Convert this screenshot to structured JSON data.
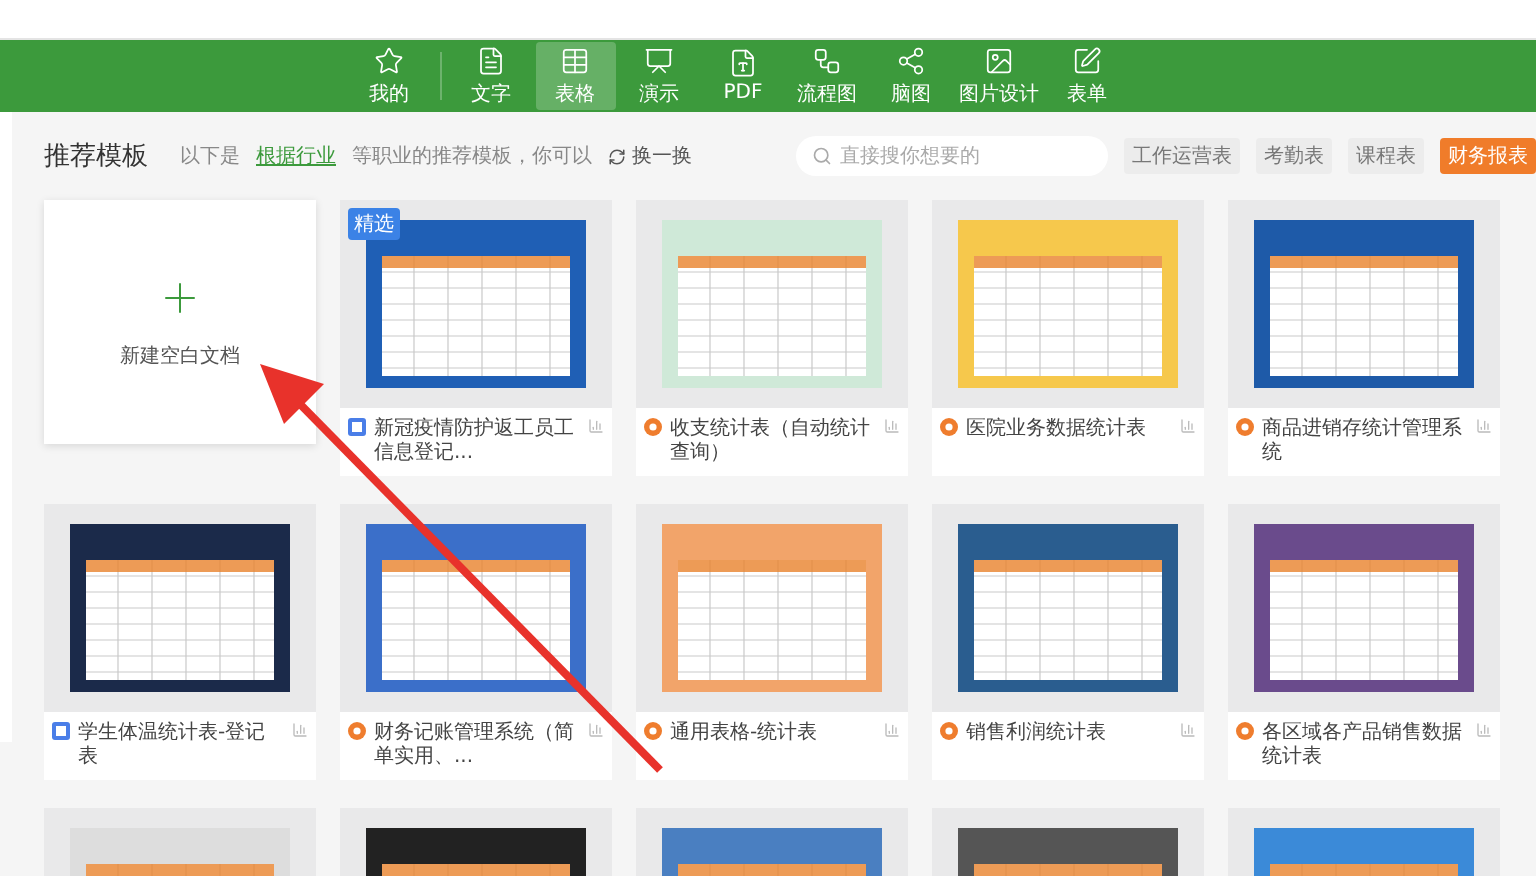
{
  "nav": {
    "items": [
      {
        "label": "我的",
        "selected": false
      },
      {
        "label": "文字",
        "selected": false
      },
      {
        "label": "表格",
        "selected": true
      },
      {
        "label": "演示",
        "selected": false
      },
      {
        "label": "PDF",
        "selected": false
      },
      {
        "label": "流程图",
        "selected": false
      },
      {
        "label": "脑图",
        "selected": false
      },
      {
        "label": "图片设计",
        "selected": false
      },
      {
        "label": "表单",
        "selected": false
      }
    ]
  },
  "header": {
    "title": "推荐模板",
    "intro_before": "以下是",
    "industry_link": "根据行业",
    "intro_after": "等职业的推荐模板，你可以",
    "refresh": "换一换"
  },
  "search": {
    "placeholder": "直接搜你想要的"
  },
  "tags": [
    {
      "label": "工作运营表",
      "kind": "plain"
    },
    {
      "label": "考勤表",
      "kind": "plain"
    },
    {
      "label": "课程表",
      "kind": "plain"
    },
    {
      "label": "财务报表",
      "kind": "highlight"
    }
  ],
  "new_blank": {
    "label": "新建空白文档"
  },
  "templates": [
    {
      "kind": "sheet",
      "title": "新冠疫情防护返工员工信息登记...",
      "badge": "精选"
    },
    {
      "kind": "app",
      "title": "收支统计表（自动统计查询）"
    },
    {
      "kind": "app",
      "title": "医院业务数据统计表"
    },
    {
      "kind": "app",
      "title": "商品进销存统计管理系统"
    },
    {
      "kind": "sheet",
      "title": "学生体温统计表-登记表"
    },
    {
      "kind": "app",
      "title": "财务记账管理系统（简单实用、..."
    },
    {
      "kind": "app",
      "title": "通用表格-统计表"
    },
    {
      "kind": "app",
      "title": "销售利润统计表"
    },
    {
      "kind": "app",
      "title": "各区域各产品销售数据统计表"
    },
    {
      "kind": "preview"
    },
    {
      "kind": "preview"
    },
    {
      "kind": "preview"
    },
    {
      "kind": "preview"
    },
    {
      "kind": "preview"
    }
  ]
}
